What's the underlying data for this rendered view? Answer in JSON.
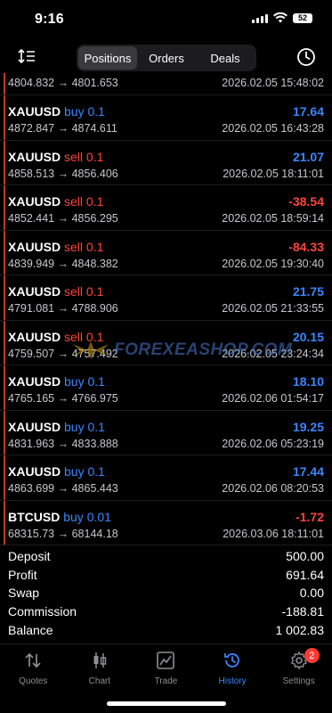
{
  "status_bar": {
    "time": "9:16",
    "battery": "52"
  },
  "tabs_top": [
    {
      "label": "Positions",
      "active": true
    },
    {
      "label": "Orders",
      "active": false
    },
    {
      "label": "Deals",
      "active": false
    }
  ],
  "deals": [
    {
      "symbol": "",
      "side": "",
      "volume": "",
      "profit": "",
      "prices": "4804.832 → 4801.653",
      "time": "2026.02.05 15:48:02",
      "partial": true
    },
    {
      "symbol": "XAUUSD",
      "side": "buy",
      "volume": "0.1",
      "profit": "17.64",
      "prices": "4872.847 → 4874.611",
      "time": "2026.02.05 16:43:28"
    },
    {
      "symbol": "XAUUSD",
      "side": "sell",
      "volume": "0.1",
      "profit": "21.07",
      "prices": "4858.513 → 4856.406",
      "time": "2026.02.05 18:11:01"
    },
    {
      "symbol": "XAUUSD",
      "side": "sell",
      "volume": "0.1",
      "profit": "-38.54",
      "prices": "4852.441 → 4856.295",
      "time": "2026.02.05 18:59:14"
    },
    {
      "symbol": "XAUUSD",
      "side": "sell",
      "volume": "0.1",
      "profit": "-84.33",
      "prices": "4839.949 → 4848.382",
      "time": "2026.02.05 19:30:40"
    },
    {
      "symbol": "XAUUSD",
      "side": "sell",
      "volume": "0.1",
      "profit": "21.75",
      "prices": "4791.081 → 4788.906",
      "time": "2026.02.05 21:33:55"
    },
    {
      "symbol": "XAUUSD",
      "side": "sell",
      "volume": "0.1",
      "profit": "20.15",
      "prices": "4759.507 → 4757.492",
      "time": "2026.02.05 23:24:34"
    },
    {
      "symbol": "XAUUSD",
      "side": "buy",
      "volume": "0.1",
      "profit": "18.10",
      "prices": "4765.165 → 4766.975",
      "time": "2026.02.06 01:54:17"
    },
    {
      "symbol": "XAUUSD",
      "side": "buy",
      "volume": "0.1",
      "profit": "19.25",
      "prices": "4831.963 → 4833.888",
      "time": "2026.02.06 05:23:19"
    },
    {
      "symbol": "XAUUSD",
      "side": "buy",
      "volume": "0.1",
      "profit": "17.44",
      "prices": "4863.699 → 4865.443",
      "time": "2026.02.06 08:20:53"
    },
    {
      "symbol": "BTCUSD",
      "side": "buy",
      "volume": "0.01",
      "profit": "-1.72",
      "prices": "68315.73 → 68144.18",
      "time": "2026.03.06 18:11:01"
    }
  ],
  "summary": [
    {
      "label": "Deposit",
      "value": "500.00"
    },
    {
      "label": "Profit",
      "value": "691.64"
    },
    {
      "label": "Swap",
      "value": "0.00"
    },
    {
      "label": "Commission",
      "value": "-188.81"
    },
    {
      "label": "Balance",
      "value": "1 002.83"
    }
  ],
  "watermark": "FOREXEASHOP.COM",
  "bottom_tabs": [
    {
      "label": "Quotes",
      "icon": "quotes-icon",
      "active": false
    },
    {
      "label": "Chart",
      "icon": "chart-icon",
      "active": false
    },
    {
      "label": "Trade",
      "icon": "trade-icon",
      "active": false
    },
    {
      "label": "History",
      "icon": "history-icon",
      "active": true
    },
    {
      "label": "Settings",
      "icon": "settings-icon",
      "active": false,
      "badge": "2"
    }
  ],
  "colors": {
    "buy": "#3a86ff",
    "sell": "#ff453a",
    "accent": "#3a86ff"
  }
}
